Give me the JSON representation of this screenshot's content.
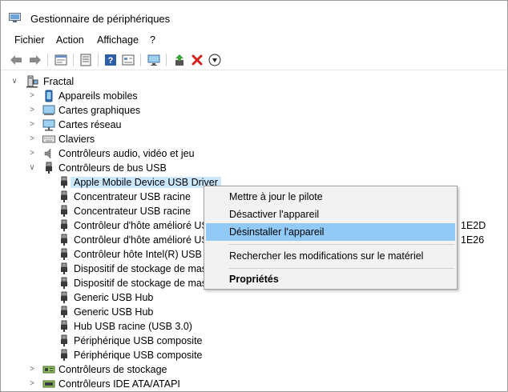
{
  "window": {
    "title": "Gestionnaire de périphériques"
  },
  "menu": [
    "Fichier",
    "Action",
    "Affichage",
    "?"
  ],
  "toolbar": {
    "icons": [
      "back-arrow-icon",
      "forward-arrow-icon",
      "properties-window-icon",
      "device-list-icon",
      "help-icon",
      "view-icon",
      "monitor-icon",
      "update-driver-icon",
      "uninstall-x-icon",
      "disable-down-icon"
    ]
  },
  "tree": {
    "root": "Fractal",
    "categories": [
      "Appareils mobiles",
      "Cartes graphiques",
      "Cartes réseau",
      "Claviers",
      "Contrôleurs audio, vidéo et jeu",
      "Contrôleurs de bus USB"
    ],
    "usb_children": [
      "Apple Mobile Device USB Driver",
      "Concentrateur USB racine",
      "Concentrateur USB racine",
      "Contrôleur d'hôte amélioré US",
      "Contrôleur d'hôte amélioré US",
      "Contrôleur hôte Intel(R) USB 3",
      "Dispositif de stockage de mass",
      "Dispositif de stockage de mass",
      "Generic USB Hub",
      "Generic USB Hub",
      "Hub USB racine (USB 3.0)",
      "Périphérique USB composite",
      "Périphérique USB composite"
    ],
    "trailing": {
      "row3": "1E2D",
      "row4": "1E26"
    },
    "after_categories": [
      "Contrôleurs de stockage",
      "Contrôleurs IDE ATA/ATAPI"
    ]
  },
  "context_menu": {
    "items": [
      "Mettre à jour le pilote",
      "Désactiver l'appareil",
      "Désinstaller l'appareil",
      "Rechercher les modifications sur le matériel",
      "Propriétés"
    ]
  },
  "colors": {
    "selection": "#cce8ff",
    "menu_highlight": "#91c9f7",
    "menu_bg": "#f2f2f2"
  }
}
